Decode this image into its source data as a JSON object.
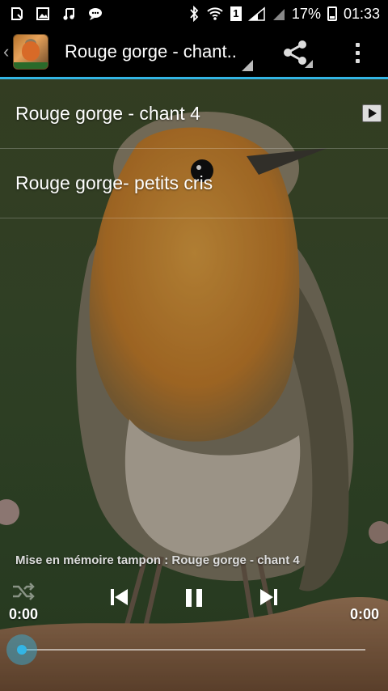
{
  "status_bar": {
    "battery_percent": "17%",
    "time": "01:33",
    "sim_label": "1",
    "icons": [
      "notification-icon",
      "image-icon",
      "music-icon",
      "chat-icon",
      "bluetooth-icon",
      "wifi-icon",
      "sim-icon",
      "signal-icon",
      "battery-icon"
    ]
  },
  "action_bar": {
    "title": "Rouge gorge - chant..",
    "icons": [
      "back-chevron-icon",
      "app-icon",
      "share-icon",
      "overflow-menu-icon"
    ]
  },
  "tracks": [
    {
      "label": "Rouge gorge - chant 4",
      "playing": true
    },
    {
      "label": "Rouge gorge- petits cris",
      "playing": false
    }
  ],
  "player": {
    "buffer_text": "Mise en mémoire tampon : Rouge gorge - chant 4",
    "current_time": "0:00",
    "total_time": "0:00",
    "progress": 0,
    "icons": [
      "shuffle-icon",
      "previous-icon",
      "pause-icon",
      "next-icon"
    ]
  },
  "colors": {
    "accent": "#33b5e5",
    "statusbar_bg": "#000000",
    "background_green": "#3a4d2c"
  }
}
